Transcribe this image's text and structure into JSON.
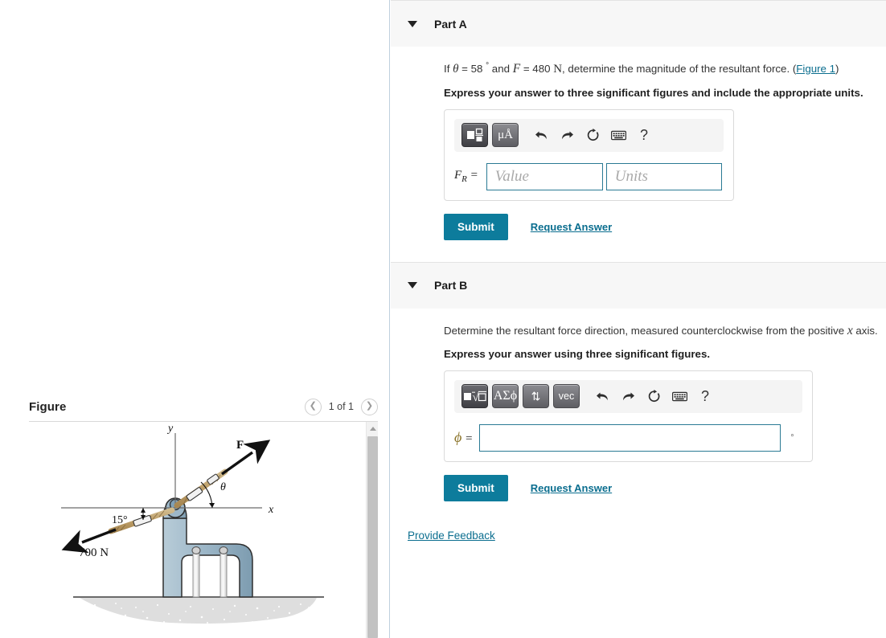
{
  "figure_panel": {
    "title": "Figure",
    "pager": {
      "prev_icon": "chevron-left-icon",
      "label": "1 of 1",
      "next_icon": "chevron-right-icon"
    },
    "diagram": {
      "axis_y_label": "y",
      "axis_x_label": "x",
      "force_f_label": "F",
      "theta_label": "θ",
      "angle_15_label": "15°",
      "force_700_label": "700 N",
      "colors": {
        "bracket_fill": "#9cb6c6",
        "bracket_stroke": "#2b2b2b",
        "rope": "#d8bb86",
        "ground": "#d8d8d8",
        "arrow": "#111111"
      }
    }
  },
  "parts": [
    {
      "id": "part-a",
      "caret_icon": "caret-down-icon",
      "title": "Part A",
      "question_prefix": "If ",
      "question_theta": "θ",
      "question_mid1": " = 58 ",
      "question_deg": "°",
      "question_mid2": " and ",
      "question_f": "F",
      "question_mid3": " = 480 ",
      "question_unit": "N",
      "question_suffix": ", determine the magnitude of the resultant force. (",
      "figure_link": "Figure 1",
      "question_end": ")",
      "instruction": "Express your answer to three significant figures and include the appropriate units.",
      "toolbar": {
        "keys": [
          {
            "name": "template-icon",
            "glyph": "template",
            "selected": true
          },
          {
            "name": "units-icon",
            "glyph": "μÅ",
            "selected": false
          }
        ],
        "icons": [
          {
            "name": "undo-icon",
            "glyph": "↶"
          },
          {
            "name": "redo-icon",
            "glyph": "↷"
          },
          {
            "name": "reset-icon",
            "glyph": "↻"
          },
          {
            "name": "keyboard-icon",
            "glyph": "keyboard"
          },
          {
            "name": "help-icon",
            "glyph": "?"
          }
        ]
      },
      "answer_label": "F",
      "answer_label_sub": "R",
      "answer_label_eq": " =",
      "value_placeholder": "Value",
      "units_placeholder": "Units",
      "value_current": "",
      "units_current": "",
      "submit_label": "Submit",
      "request_label": "Request Answer"
    },
    {
      "id": "part-b",
      "caret_icon": "caret-down-icon",
      "title": "Part B",
      "question_prefix": "Determine the resultant force direction, measured counterclockwise from the positive ",
      "question_x": "x",
      "question_suffix": " axis.",
      "instruction": "Express your answer using three significant figures.",
      "toolbar": {
        "keys": [
          {
            "name": "template-radical-icon",
            "glyph": "radical",
            "selected": true
          },
          {
            "name": "greek-letters-icon",
            "glyph": "ΑΣϕ",
            "selected": false
          },
          {
            "name": "arrows-icon",
            "glyph": "⇅",
            "selected": false
          },
          {
            "name": "vector-icon",
            "glyph": "vec",
            "selected": false
          }
        ],
        "icons": [
          {
            "name": "undo-icon",
            "glyph": "↶"
          },
          {
            "name": "redo-icon",
            "glyph": "↷"
          },
          {
            "name": "reset-icon",
            "glyph": "↻"
          },
          {
            "name": "keyboard-icon",
            "glyph": "keyboard"
          },
          {
            "name": "help-icon",
            "glyph": "?"
          }
        ]
      },
      "answer_label": "ϕ",
      "answer_label_eq": " =",
      "value_current": "",
      "degree_suffix": "°",
      "submit_label": "Submit",
      "request_label": "Request Answer"
    }
  ],
  "feedback": {
    "label": "Provide Feedback"
  },
  "theme": {
    "accent": "#0d7c9c",
    "link": "#0b6e8f",
    "header_bg": "#f7f7f7",
    "field_border": "#2a7a94"
  }
}
